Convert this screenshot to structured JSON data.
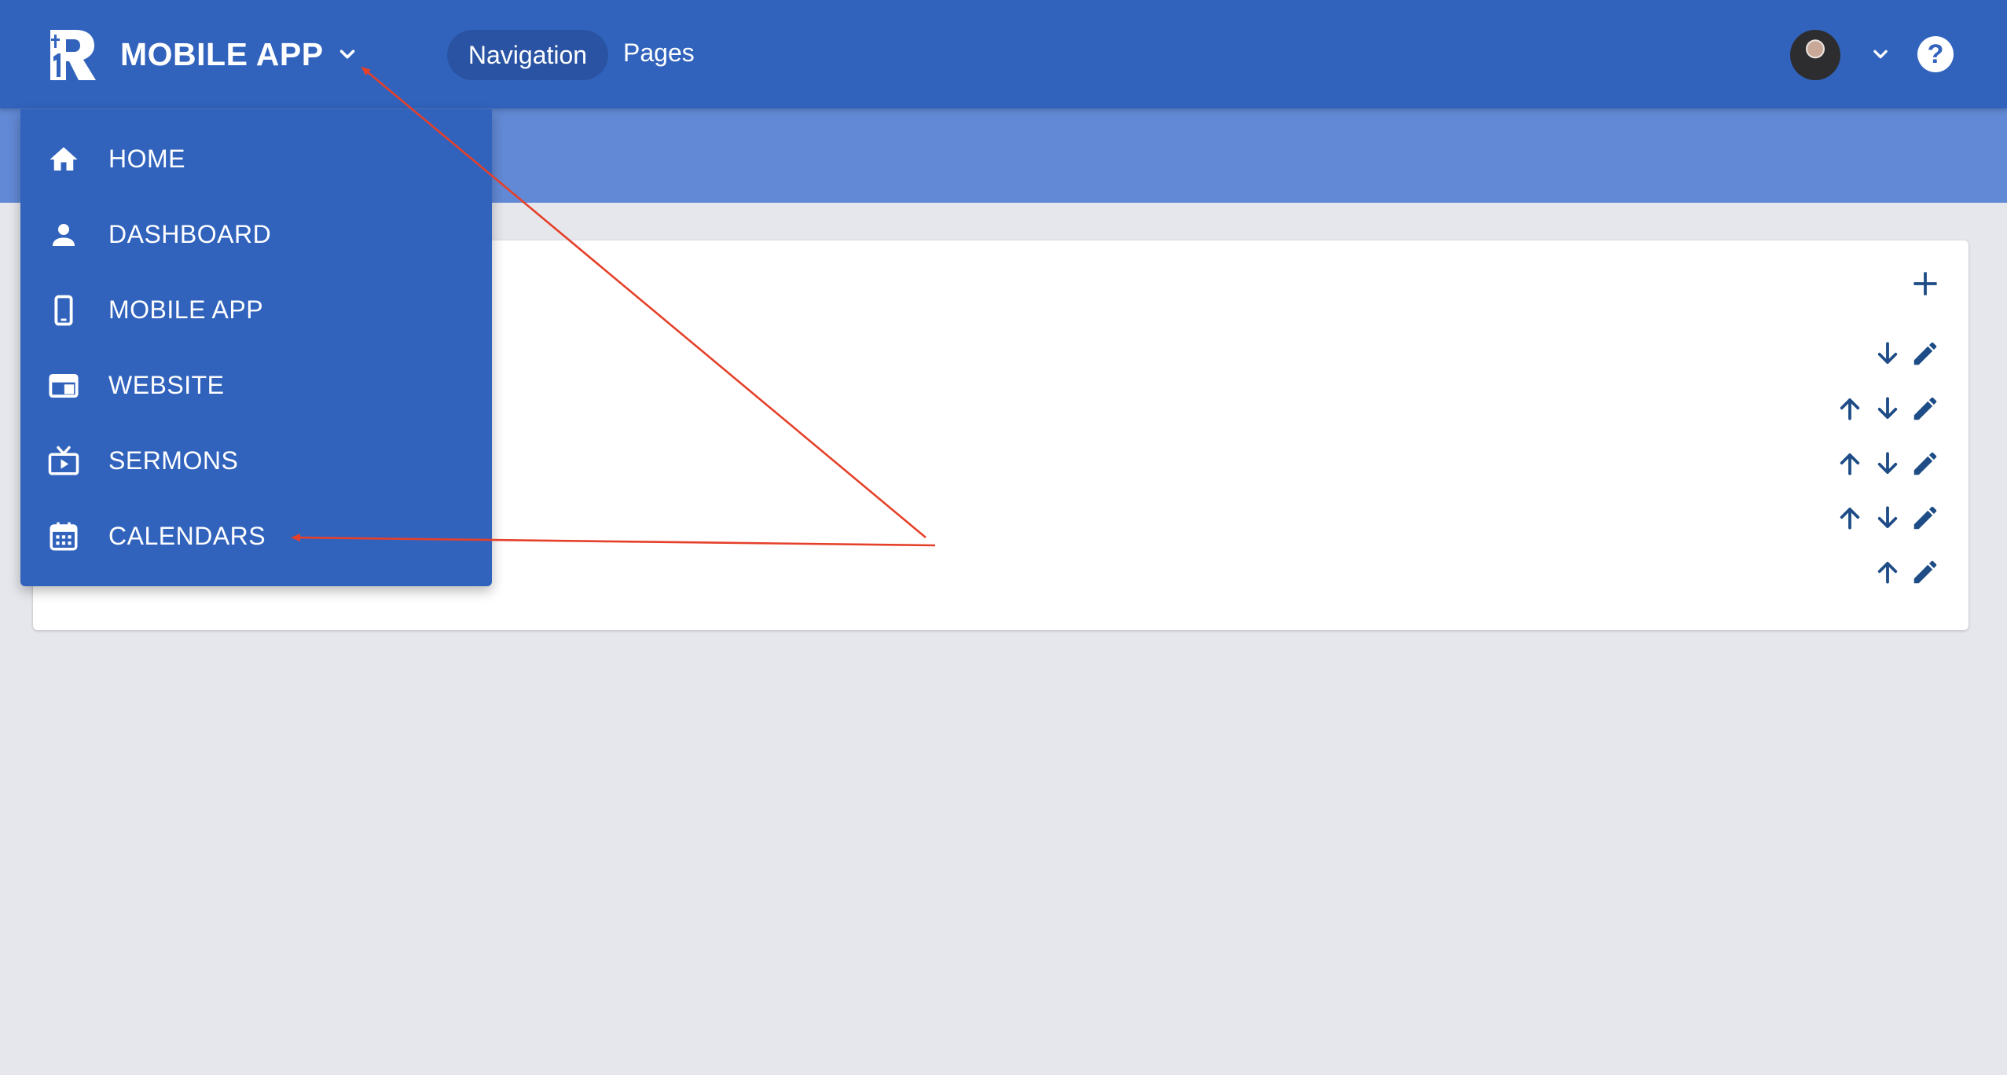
{
  "header": {
    "app_title": "MOBILE APP",
    "tabs": [
      {
        "label": "Navigation",
        "active": true
      },
      {
        "label": "Pages",
        "active": false
      }
    ],
    "help_label": "?"
  },
  "menu": {
    "items": [
      {
        "label": "HOME",
        "icon": "home-icon"
      },
      {
        "label": "DASHBOARD",
        "icon": "person-icon"
      },
      {
        "label": "MOBILE APP",
        "icon": "phone-icon"
      },
      {
        "label": "WEBSITE",
        "icon": "website-icon"
      },
      {
        "label": "SERMONS",
        "icon": "tv-play-icon"
      },
      {
        "label": "CALENDARS",
        "icon": "calendar-icon"
      }
    ]
  },
  "card": {
    "rows": [
      {
        "move_up": false,
        "move_down": true,
        "edit": true
      },
      {
        "move_up": true,
        "move_down": true,
        "edit": true
      },
      {
        "move_up": true,
        "move_down": true,
        "edit": true
      },
      {
        "move_up": true,
        "move_down": true,
        "edit": true
      },
      {
        "move_up": true,
        "move_down": false,
        "edit": true
      }
    ]
  },
  "colors": {
    "primary": "#3163bd",
    "primary_light": "#6289d5",
    "pill": "#2a54a3",
    "icon_dark": "#1e4c86",
    "annotation": "#e5402a",
    "background": "#e6e7ec"
  }
}
